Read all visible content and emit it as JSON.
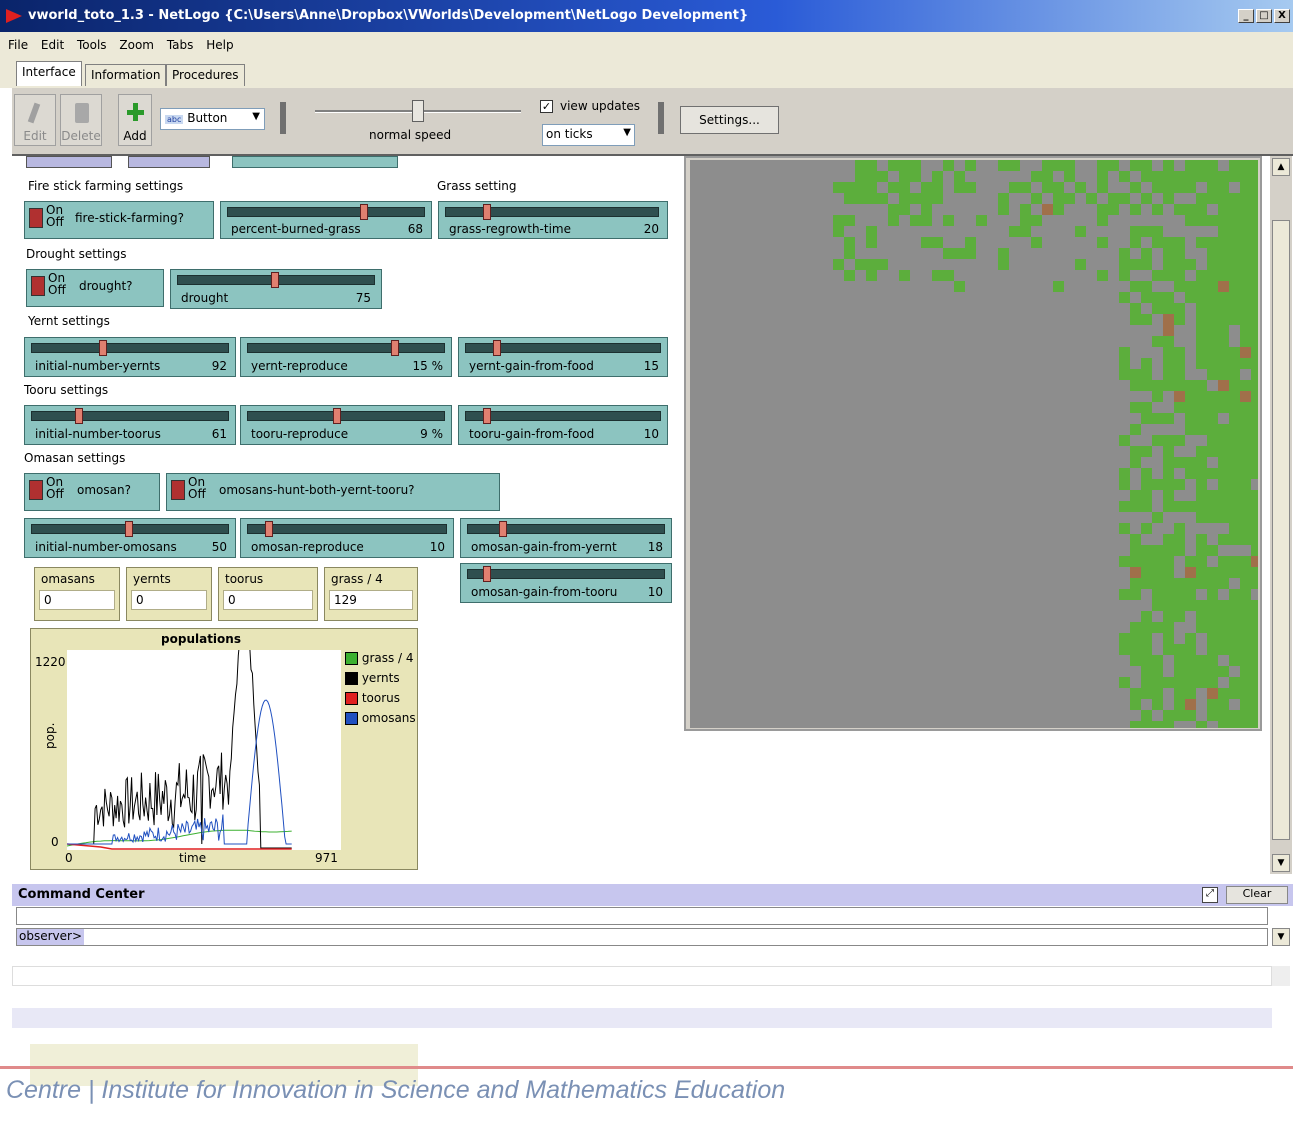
{
  "window": {
    "title": "vworld_toto_1.3 - NetLogo {C:\\Users\\Anne\\Dropbox\\VWorlds\\Development\\NetLogo Development}",
    "min": "_",
    "max": "□",
    "close": "X"
  },
  "menu": [
    "File",
    "Edit",
    "Tools",
    "Zoom",
    "Tabs",
    "Help"
  ],
  "tabs": [
    "Interface",
    "Information",
    "Procedures"
  ],
  "toolbar": {
    "edit": "Edit",
    "delete": "Delete",
    "add": "Add",
    "widget_type": "Button",
    "speed_label": "normal speed",
    "view_updates": "view updates",
    "update_mode": "on ticks",
    "settings": "Settings..."
  },
  "sections": {
    "fire": "Fire stick farming settings",
    "grass": "Grass setting",
    "drought": "Drought settings",
    "yernt": "Yernt settings",
    "tooru": "Tooru settings",
    "omasan": "Omasan settings"
  },
  "switch_on": "On",
  "switch_off": "Off",
  "switches": {
    "fire": "fire-stick-farming?",
    "drought": "drought?",
    "omosan": "omosan?",
    "hunt": "omosans-hunt-both-yernt-tooru?"
  },
  "sliders": {
    "percent_burned": {
      "label": "percent-burned-grass",
      "value": "68",
      "fraction": 0.68
    },
    "grass_regrowth": {
      "label": "grass-regrowth-time",
      "value": "20",
      "fraction": 0.2
    },
    "drought": {
      "label": "drought",
      "value": "75",
      "fraction": 0.5
    },
    "init_yernts": {
      "label": "initial-number-yernts",
      "value": "92",
      "fraction": 0.35
    },
    "yernt_reproduce": {
      "label": "yernt-reproduce",
      "value": "15 %",
      "fraction": 0.75
    },
    "yernt_gain": {
      "label": "yernt-gain-from-food",
      "value": "15",
      "fraction": 0.15
    },
    "init_toorus": {
      "label": "initial-number-toorus",
      "value": "61",
      "fraction": 0.23
    },
    "tooru_reproduce": {
      "label": "tooru-reproduce",
      "value": "9 %",
      "fraction": 0.45
    },
    "tooru_gain": {
      "label": "tooru-gain-from-food",
      "value": "10",
      "fraction": 0.1
    },
    "init_omosans": {
      "label": "initial-number-omosans",
      "value": "50",
      "fraction": 0.5
    },
    "omosan_reproduce": {
      "label": "omosan-reproduce",
      "value": "10",
      "fraction": 0.1
    },
    "omosan_gain_yernt": {
      "label": "omosan-gain-from-yernt",
      "value": "18",
      "fraction": 0.15
    },
    "omosan_gain_tooru": {
      "label": "omosan-gain-from-tooru",
      "value": "10",
      "fraction": 0.1
    }
  },
  "monitors": [
    {
      "label": "omasans",
      "value": "0"
    },
    {
      "label": "yernts",
      "value": "0"
    },
    {
      "label": "toorus",
      "value": "0"
    },
    {
      "label": "grass / 4",
      "value": "129"
    }
  ],
  "plot": {
    "title": "populations",
    "ylabel": "pop.",
    "xlabel": "time",
    "ymax_label": "1220",
    "ymin_label": "0",
    "xmin_label": "0",
    "xmax_label": "971",
    "legend": [
      {
        "name": "grass / 4",
        "color": "#3cb030"
      },
      {
        "name": "yernts",
        "color": "#000000"
      },
      {
        "name": "toorus",
        "color": "#e02020"
      },
      {
        "name": "omosans",
        "color": "#2050c0"
      }
    ]
  },
  "command_center": {
    "title": "Command Center",
    "clear": "Clear",
    "prompt": "observer>"
  },
  "footer": "Centre | Institute for Innovation in Science and Mathematics Education"
}
